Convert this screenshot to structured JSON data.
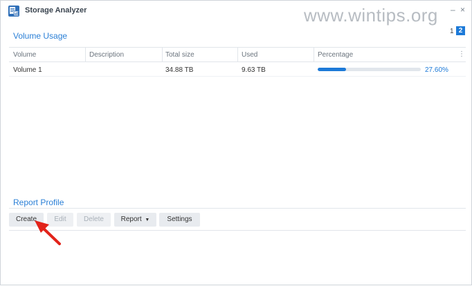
{
  "window": {
    "title": "Storage Analyzer",
    "watermark": "www.wintips.org"
  },
  "volume_usage": {
    "title": "Volume Usage",
    "pages": [
      "1",
      "2"
    ],
    "current_page": "2",
    "columns": [
      "Volume",
      "Description",
      "Total size",
      "Used",
      "Percentage"
    ],
    "rows": [
      {
        "volume": "Volume 1",
        "description": "",
        "total_size": "34.88 TB",
        "used": "9.63 TB",
        "percentage": "27.60%",
        "percentage_value": 0.276
      }
    ]
  },
  "report_profile": {
    "title": "Report Profile",
    "toolbar": {
      "create": "Create",
      "edit": "Edit",
      "delete": "Delete",
      "report": "Report",
      "settings": "Settings"
    }
  },
  "colors": {
    "accent": "#1d7ad8",
    "title": "#2a7fd6",
    "annotation_arrow": "#e2231a"
  }
}
